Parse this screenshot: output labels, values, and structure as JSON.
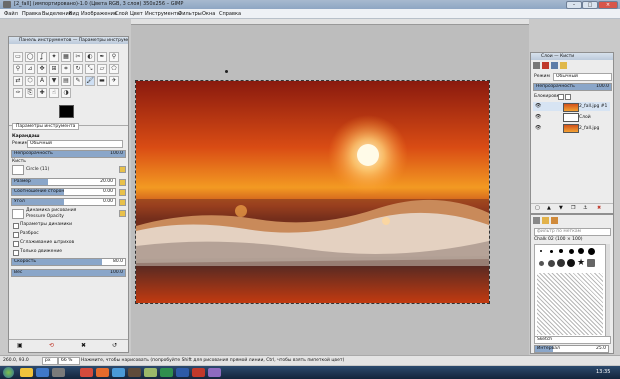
{
  "window": {
    "title": "[2_fall] (импортировано)-1.0 (Цвета RGB, 3 слоя) 350x256 – GIMP",
    "controls": [
      "–",
      "□",
      "×"
    ]
  },
  "menu": [
    "Файл",
    "Правка",
    "Выделение",
    "Вид",
    "Изображение",
    "Слой",
    "Цвет",
    "Инструменты",
    "Фильтры",
    "Окна",
    "Справка"
  ],
  "toolbox": {
    "title": "Панель инструментов — Параметры инструментов",
    "tab_label": "Параметры инструмента",
    "tool_name": "Карандаш",
    "mode_label": "Режим",
    "mode_value": "Обычный",
    "opacity_label": "Непрозрачность",
    "opacity_value": "100.0",
    "opacity_fraction": 1.0,
    "brush_label": "Кисть",
    "brush_value": "Circle (11)",
    "size_label": "Размер",
    "size_value": "20.00",
    "size_fraction": 0.35,
    "ratio_label": "Соотношение сторон",
    "ratio_value": "0.00",
    "ratio_fraction": 0.5,
    "angle_label": "Угол",
    "angle_value": "0.00",
    "angle_fraction": 0.5,
    "dynamics_label": "Динамика рисования",
    "dynamics_value": "Pressure Opacity",
    "options": [
      "Параметры динамики",
      "Разброс",
      "Сглаживание штрихов",
      "Только движение"
    ],
    "speed_label": "Скорость",
    "speed_value": "80.0",
    "speed_fraction": 0.8,
    "weight_label": "Вес",
    "weight_value": "100.0",
    "weight_fraction": 1.0
  },
  "layers": {
    "title": "Слои — Кисти",
    "mode_label": "Режим",
    "mode_value": "Обычный",
    "opacity_label": "Непрозрачность",
    "opacity_value": "100.0",
    "lock_label": "Блокировка:",
    "items": [
      "2_fall.jpg #1",
      "Слой",
      "2_fall.jpg"
    ]
  },
  "brushes": {
    "filter_placeholder": "фильтр по меткам",
    "current": "Chalk 02 (100 × 100)",
    "preset": "Sketch",
    "spacing_label": "Интервал",
    "spacing_value": "25.0"
  },
  "status": {
    "coords": "260.0, 93.0",
    "unit": "px",
    "zoom": "66 %",
    "hint": "Нажмите, чтобы нарисовать (попробуйте Shift для рисования прямой линии, Ctrl, чтобы взять пипеткой цвет)"
  },
  "taskbar": {
    "clock": "13:35"
  }
}
